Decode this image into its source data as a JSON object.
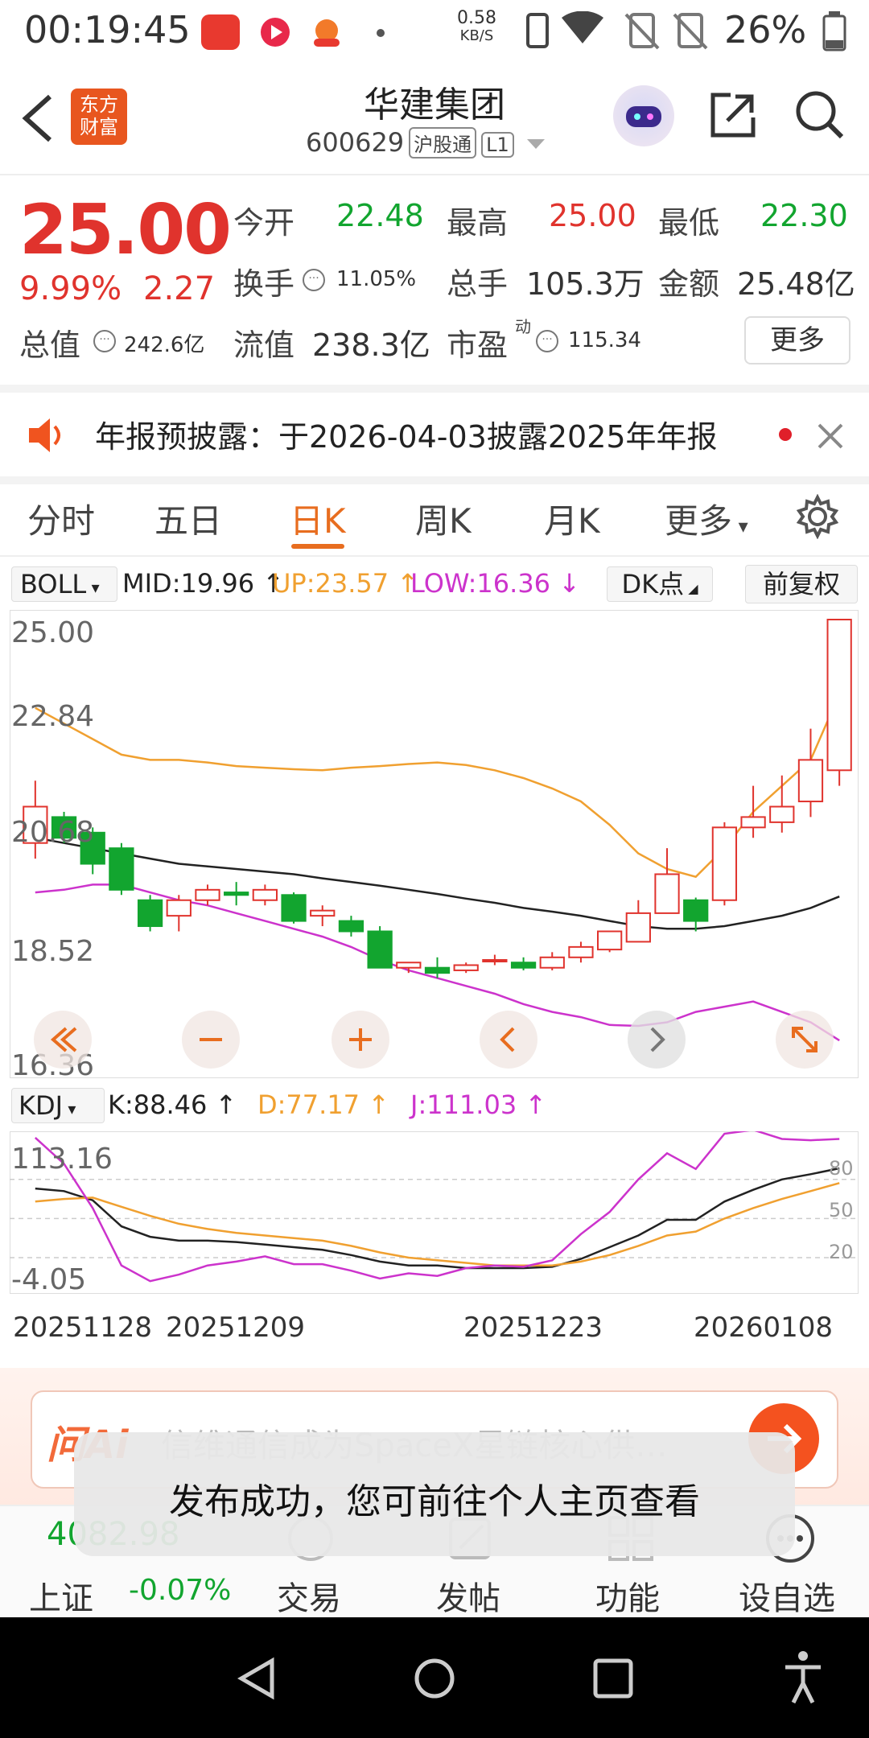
{
  "status_bar": {
    "time": "00:19:45",
    "net_speed_value": "0.58",
    "net_speed_unit": "KB/S",
    "battery": "26%"
  },
  "header": {
    "title": "华建集团",
    "code": "600629",
    "tags": [
      "沪股通",
      "L1"
    ],
    "logo_text": "东方\n财富"
  },
  "quote": {
    "price": "25.00",
    "change_pct": "9.99%",
    "change_amt": "2.27",
    "open_label": "今开",
    "open": "22.48",
    "high_label": "最高",
    "high": "25.00",
    "low_label": "最低",
    "low": "22.30",
    "turnover_label": "换手",
    "turnover": "11.05%",
    "volume_label": "总手",
    "volume": "105.3万",
    "amount_label": "金额",
    "amount": "25.48亿",
    "mktcap_label": "总值",
    "mktcap": "242.6亿",
    "float_label": "流值",
    "float_cap": "238.3亿",
    "pe_label": "市盈",
    "pe_sup": "动",
    "pe": "115.34",
    "more": "更多"
  },
  "notice": {
    "text": "年报预披露：于2026-04-03披露2025年年报"
  },
  "tabs": {
    "items": [
      "分时",
      "五日",
      "日K",
      "周K",
      "月K",
      "更多"
    ],
    "active": "日K"
  },
  "boll": {
    "name": "BOLL",
    "mid": "MID:19.96",
    "up": "UP:23.57",
    "low": "LOW:16.36",
    "dk": "DK点",
    "adjust": "前复权"
  },
  "kdj": {
    "name": "KDJ",
    "k": "K:88.46",
    "d": "D:77.17",
    "j": "J:111.03"
  },
  "colors": {
    "up": "#e0332d",
    "down": "#12a52f",
    "mid": "#222222",
    "upper": "#f0a030",
    "lower": "#cc33cc",
    "accent": "#e86d1f"
  },
  "chart_data": [
    {
      "type": "candlestick",
      "title": "日K",
      "indicator": "BOLL",
      "y_ticks": [
        "25.00",
        "22.84",
        "20.68",
        "18.52",
        "16.36"
      ],
      "ylim": [
        16.36,
        25.0
      ],
      "candles": [
        {
          "o": 20.7,
          "c": 21.4,
          "h": 21.9,
          "l": 20.4
        },
        {
          "o": 21.2,
          "c": 20.8,
          "h": 21.3,
          "l": 20.7
        },
        {
          "o": 20.9,
          "c": 20.3,
          "h": 21.0,
          "l": 20.1
        },
        {
          "o": 20.6,
          "c": 19.8,
          "h": 20.7,
          "l": 19.7
        },
        {
          "o": 19.6,
          "c": 19.1,
          "h": 19.7,
          "l": 19.0
        },
        {
          "o": 19.3,
          "c": 19.6,
          "h": 19.7,
          "l": 19.0
        },
        {
          "o": 19.6,
          "c": 19.8,
          "h": 19.9,
          "l": 19.5
        },
        {
          "o": 19.75,
          "c": 19.7,
          "h": 19.95,
          "l": 19.5
        },
        {
          "o": 19.6,
          "c": 19.8,
          "h": 19.9,
          "l": 19.5
        },
        {
          "o": 19.7,
          "c": 19.2,
          "h": 19.75,
          "l": 19.15
        },
        {
          "o": 19.3,
          "c": 19.4,
          "h": 19.5,
          "l": 19.1
        },
        {
          "o": 19.2,
          "c": 19.0,
          "h": 19.3,
          "l": 18.9
        },
        {
          "o": 19.0,
          "c": 18.3,
          "h": 19.1,
          "l": 18.3
        },
        {
          "o": 18.3,
          "c": 18.4,
          "h": 18.4,
          "l": 18.2
        },
        {
          "o": 18.3,
          "c": 18.2,
          "h": 18.5,
          "l": 18.1
        },
        {
          "o": 18.25,
          "c": 18.35,
          "h": 18.4,
          "l": 18.2
        },
        {
          "o": 18.45,
          "c": 18.45,
          "h": 18.55,
          "l": 18.35
        },
        {
          "o": 18.4,
          "c": 18.3,
          "h": 18.5,
          "l": 18.25
        },
        {
          "o": 18.3,
          "c": 18.5,
          "h": 18.6,
          "l": 18.25
        },
        {
          "o": 18.5,
          "c": 18.7,
          "h": 18.8,
          "l": 18.4
        },
        {
          "o": 18.65,
          "c": 19.0,
          "h": 19.0,
          "l": 18.6
        },
        {
          "o": 18.8,
          "c": 19.35,
          "h": 19.6,
          "l": 18.8
        },
        {
          "o": 19.35,
          "c": 20.1,
          "h": 20.6,
          "l": 19.35
        },
        {
          "o": 19.6,
          "c": 19.2,
          "h": 19.65,
          "l": 19.0
        },
        {
          "o": 19.6,
          "c": 21.0,
          "h": 21.1,
          "l": 19.5
        },
        {
          "o": 21.0,
          "c": 21.2,
          "h": 21.8,
          "l": 20.8
        },
        {
          "o": 21.1,
          "c": 21.4,
          "h": 22.0,
          "l": 20.9
        },
        {
          "o": 21.5,
          "c": 22.3,
          "h": 22.9,
          "l": 21.2
        },
        {
          "o": 22.1,
          "c": 25.0,
          "h": 25.0,
          "l": 21.8
        }
      ],
      "mid": [
        20.8,
        20.7,
        20.6,
        20.5,
        20.4,
        20.3,
        20.25,
        20.2,
        20.15,
        20.1,
        20.02,
        19.95,
        19.88,
        19.8,
        19.72,
        19.63,
        19.55,
        19.45,
        19.38,
        19.3,
        19.2,
        19.1,
        19.05,
        19.05,
        19.1,
        19.2,
        19.3,
        19.45,
        19.67
      ],
      "upper": [
        23.3,
        23.0,
        22.7,
        22.4,
        22.3,
        22.3,
        22.25,
        22.18,
        22.15,
        22.12,
        22.1,
        22.15,
        22.18,
        22.22,
        22.25,
        22.2,
        22.1,
        21.95,
        21.75,
        21.5,
        21.05,
        20.5,
        20.2,
        20.05,
        20.6,
        21.3,
        21.8,
        22.3,
        23.57
      ],
      "lower": [
        19.75,
        19.8,
        19.9,
        19.9,
        19.75,
        19.6,
        19.5,
        19.35,
        19.2,
        19.05,
        18.9,
        18.7,
        18.45,
        18.25,
        18.1,
        17.95,
        17.8,
        17.6,
        17.45,
        17.35,
        17.2,
        17.18,
        17.25,
        17.45,
        17.55,
        17.65,
        17.45,
        17.25,
        16.9
      ]
    },
    {
      "type": "line",
      "title": "KDJ",
      "y_ticks_left": [
        "113.16",
        "-4.05"
      ],
      "y_ticks_right": [
        "80",
        "50",
        "20"
      ],
      "ylim": [
        -4.05,
        113.16
      ],
      "x_labels": [
        "20251128",
        "20251209",
        "20251223",
        "20260108"
      ],
      "series": [
        {
          "name": "K",
          "values": [
            73,
            71,
            64,
            44,
            36,
            33,
            33,
            32,
            30,
            28,
            26,
            22,
            17,
            14,
            14,
            12,
            12,
            12,
            13,
            19,
            28,
            37,
            49,
            49,
            63,
            72,
            80,
            84,
            88.46
          ]
        },
        {
          "name": "D",
          "values": [
            63,
            65,
            66,
            59,
            52,
            46,
            42,
            39,
            37,
            35,
            33,
            29,
            24,
            20,
            18,
            16,
            14,
            14,
            14,
            17,
            22,
            29,
            37,
            40,
            50,
            58,
            65,
            71,
            77.17
          ]
        },
        {
          "name": "J",
          "values": [
            112,
            92,
            58,
            14,
            2,
            7,
            14,
            17,
            21,
            15,
            15,
            10,
            4,
            8,
            6,
            12,
            14,
            13,
            18,
            38,
            55,
            80,
            100,
            88,
            115,
            118,
            111,
            110,
            111.03
          ]
        }
      ]
    }
  ],
  "ask_ai": {
    "brand": "问Ai",
    "placeholder": "信维通信成为SpaceX星链核心供…"
  },
  "bottom_bar": {
    "index_value": "4082.98",
    "index_name": "上证",
    "index_change": "-0.07%",
    "items": [
      "交易",
      "发帖",
      "功能",
      "设自选"
    ]
  },
  "toast": {
    "message": "发布成功，您可前往个人主页查看"
  }
}
